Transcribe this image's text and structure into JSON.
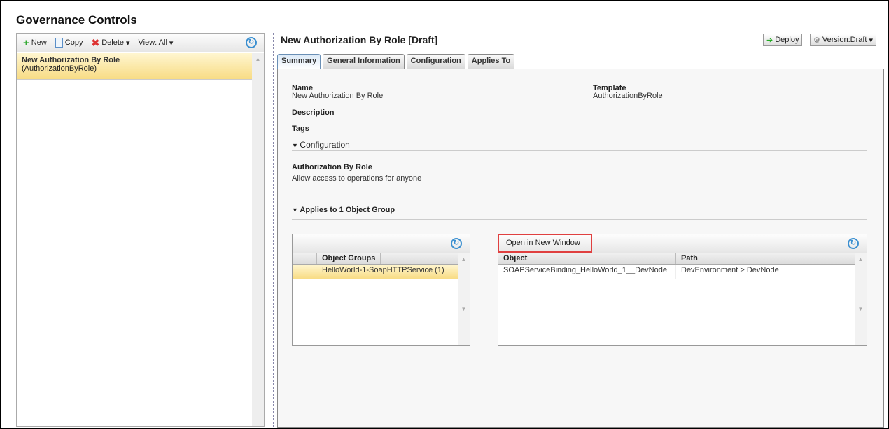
{
  "app": {
    "title": "Governance Controls"
  },
  "left": {
    "toolbar": {
      "new": "New",
      "copy": "Copy",
      "delete": "Delete",
      "view": "View: All"
    },
    "items": [
      {
        "name": "New Authorization By Role",
        "type": "(AuthorizationByRole)"
      }
    ]
  },
  "detail": {
    "title": "New Authorization By Role [Draft]",
    "deploy": "Deploy",
    "version": "Version:Draft",
    "tabs": [
      "Summary",
      "General Information",
      "Configuration",
      "Applies To"
    ],
    "summary": {
      "name_label": "Name",
      "name": "New Authorization By Role",
      "template_label": "Template",
      "template": "AuthorizationByRole",
      "description_label": "Description",
      "tags_label": "Tags",
      "configuration_header": "Configuration",
      "config_title": "Authorization By Role",
      "config_desc": "Allow access to operations for anyone",
      "applies_header": "Applies to 1 Object Group"
    },
    "groups": {
      "column": "Object Groups",
      "rows": [
        "HelloWorld-1-SoapHTTPService (1)"
      ]
    },
    "objects": {
      "open_button": "Open in New Window",
      "columns": [
        "Object",
        "Path"
      ],
      "rows": [
        {
          "object": "SOAPServiceBinding_HelloWorld_1__DevNode",
          "path": "DevEnvironment > DevNode"
        }
      ]
    }
  }
}
